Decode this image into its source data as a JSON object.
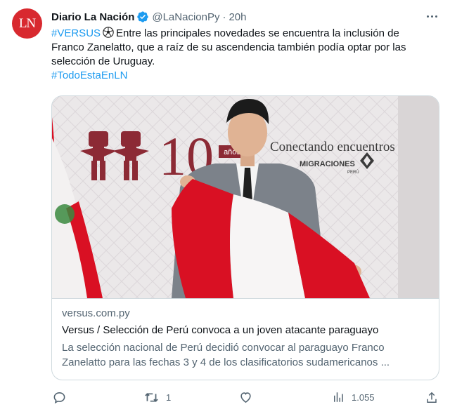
{
  "tweet": {
    "author_name": "Diario La Nación",
    "avatar_text": "LN",
    "handle": "@LaNacionPy",
    "separator": "·",
    "time": "20h",
    "text": {
      "hashtag1": "#VERSUS",
      "line1_rest": "Entre las principales novedades se encuentra la inclusión de",
      "line2": "Franco Zanelatto, que a raíz de su ascendencia también podía optar por las",
      "line3": "selección de Uruguay.",
      "hashtag2": "#TodoEstaEnLN"
    },
    "card": {
      "image_text": {
        "banner_number": "10",
        "banner_word": "años",
        "slogan": "Conectando encuentros",
        "org": "MIGRACIONES",
        "org_sub": "PERÚ"
      },
      "domain": "versus.com.py",
      "title": "Versus / Selección de Perú convoca a un joven atacante paraguayo",
      "description_line1": "La selección nacional de Perú decidió convocar al paraguayo Franco",
      "description_line2": "Zanelatto para las fechas 3 y 4 de los clasificatorios sudamericanos ..."
    },
    "actions": {
      "reply": {
        "icon": "reply-icon",
        "count": ""
      },
      "retweet": {
        "icon": "retweet-icon",
        "count": "1"
      },
      "like": {
        "icon": "like-icon",
        "count": ""
      },
      "views": {
        "icon": "views-icon",
        "count": "1.055"
      },
      "share": {
        "icon": "share-icon",
        "count": ""
      }
    }
  },
  "colors": {
    "link": "#1d9bf0",
    "verified": "#1d9bf0",
    "muted": "#536471",
    "avatar_bg": "#d8292f",
    "flag_red": "#d91023"
  }
}
